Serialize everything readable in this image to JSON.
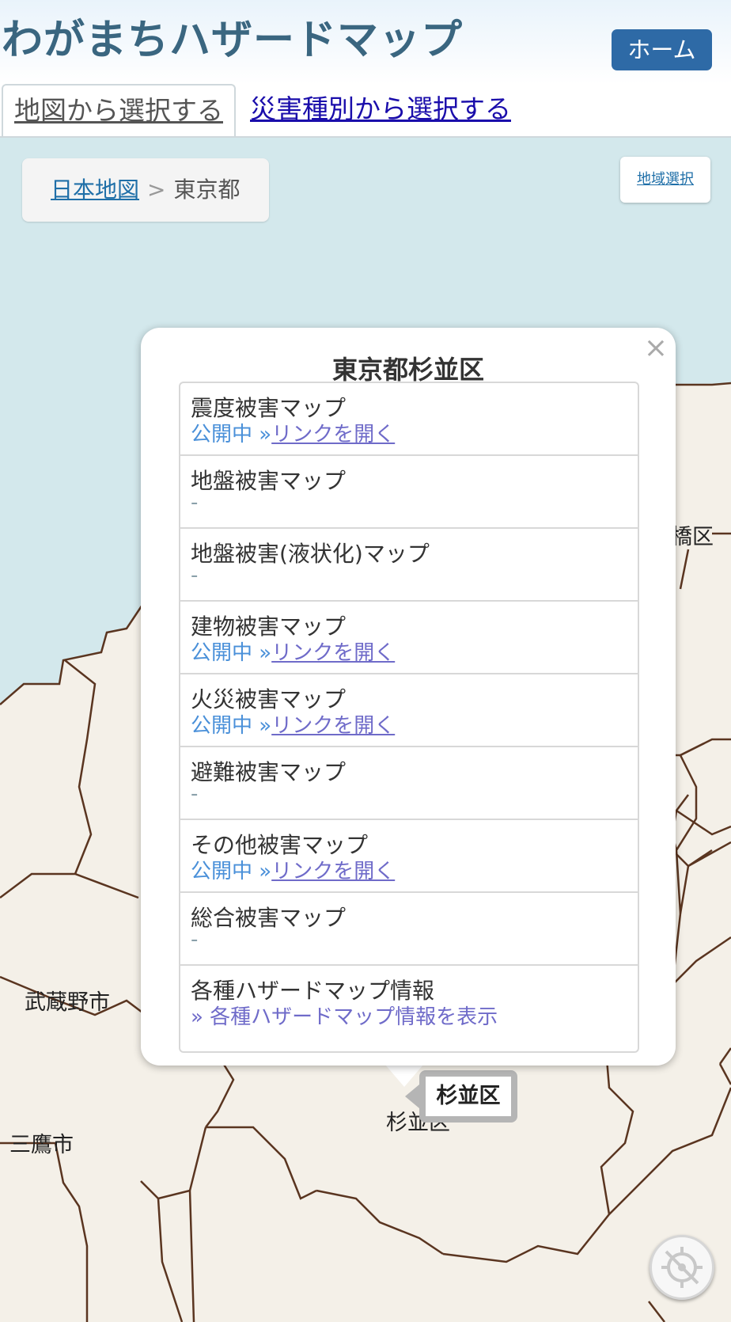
{
  "header": {
    "title": "わがまちハザードマップ",
    "home_button": "ホーム"
  },
  "tabs": {
    "map_select": "地図から選択する",
    "disaster_select": "災害種別から選択する"
  },
  "breadcrumb": {
    "root": "日本地図",
    "separator": ">",
    "current": "東京都"
  },
  "region_button": "地域選択",
  "map_labels": {
    "itabashi": "橋区",
    "musashino": "武蔵野市",
    "mitaka": "三鷹市",
    "suginami": "杉並区"
  },
  "district_pin": "杉並区",
  "popup": {
    "close": "×",
    "title": "東京都杉並区",
    "items": [
      {
        "name": "震度被害マップ",
        "open": "公開中 »",
        "link": "リンクを開く",
        "dash": ""
      },
      {
        "name": "地盤被害マップ",
        "open": "",
        "link": "",
        "dash": "-"
      },
      {
        "name": "地盤被害(液状化)マップ",
        "open": "",
        "link": "",
        "dash": "-"
      },
      {
        "name": "建物被害マップ",
        "open": "公開中 »",
        "link": "リンクを開く",
        "dash": ""
      },
      {
        "name": "火災被害マップ",
        "open": "公開中 »",
        "link": "リンクを開く",
        "dash": ""
      },
      {
        "name": "避難被害マップ",
        "open": "",
        "link": "",
        "dash": "-"
      },
      {
        "name": "その他被害マップ",
        "open": "公開中 »",
        "link": "リンクを開く",
        "dash": ""
      },
      {
        "name": "総合被害マップ",
        "open": "",
        "link": "",
        "dash": "-"
      },
      {
        "name": "各種ハザードマップ情報",
        "open": "",
        "link": "",
        "dash": "",
        "info": "» 各種ハザードマップ情報を表示"
      }
    ]
  },
  "icons": {
    "locate": "crosshair-disabled-icon"
  },
  "colors": {
    "water": "#d3e8ec",
    "land": "#f4f0e8",
    "border": "#5a3520",
    "home_button": "#2e6aa6",
    "title": "#3a6680"
  }
}
